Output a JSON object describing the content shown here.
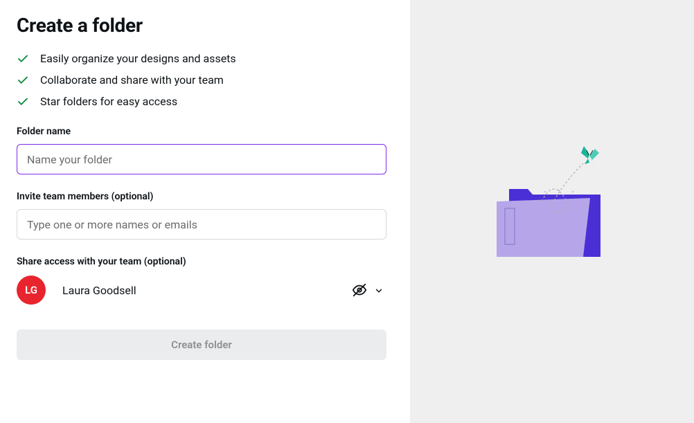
{
  "title": "Create a folder",
  "benefits": [
    "Easily organize your designs and assets",
    "Collaborate and share with your team",
    "Star folders for easy access"
  ],
  "folderName": {
    "label": "Folder name",
    "placeholder": "Name your folder",
    "value": ""
  },
  "inviteMembers": {
    "label": "Invite team members (optional)",
    "placeholder": "Type one or more names or emails",
    "value": ""
  },
  "shareAccess": {
    "label": "Share access with your team (optional)",
    "team": {
      "initials": "LG",
      "name": "Laura Goodsell"
    }
  },
  "submitButton": {
    "label": "Create folder"
  },
  "colors": {
    "accent": "#7d2ae8",
    "checkmark": "#0a8a3a",
    "avatarBg": "#e8252e"
  }
}
